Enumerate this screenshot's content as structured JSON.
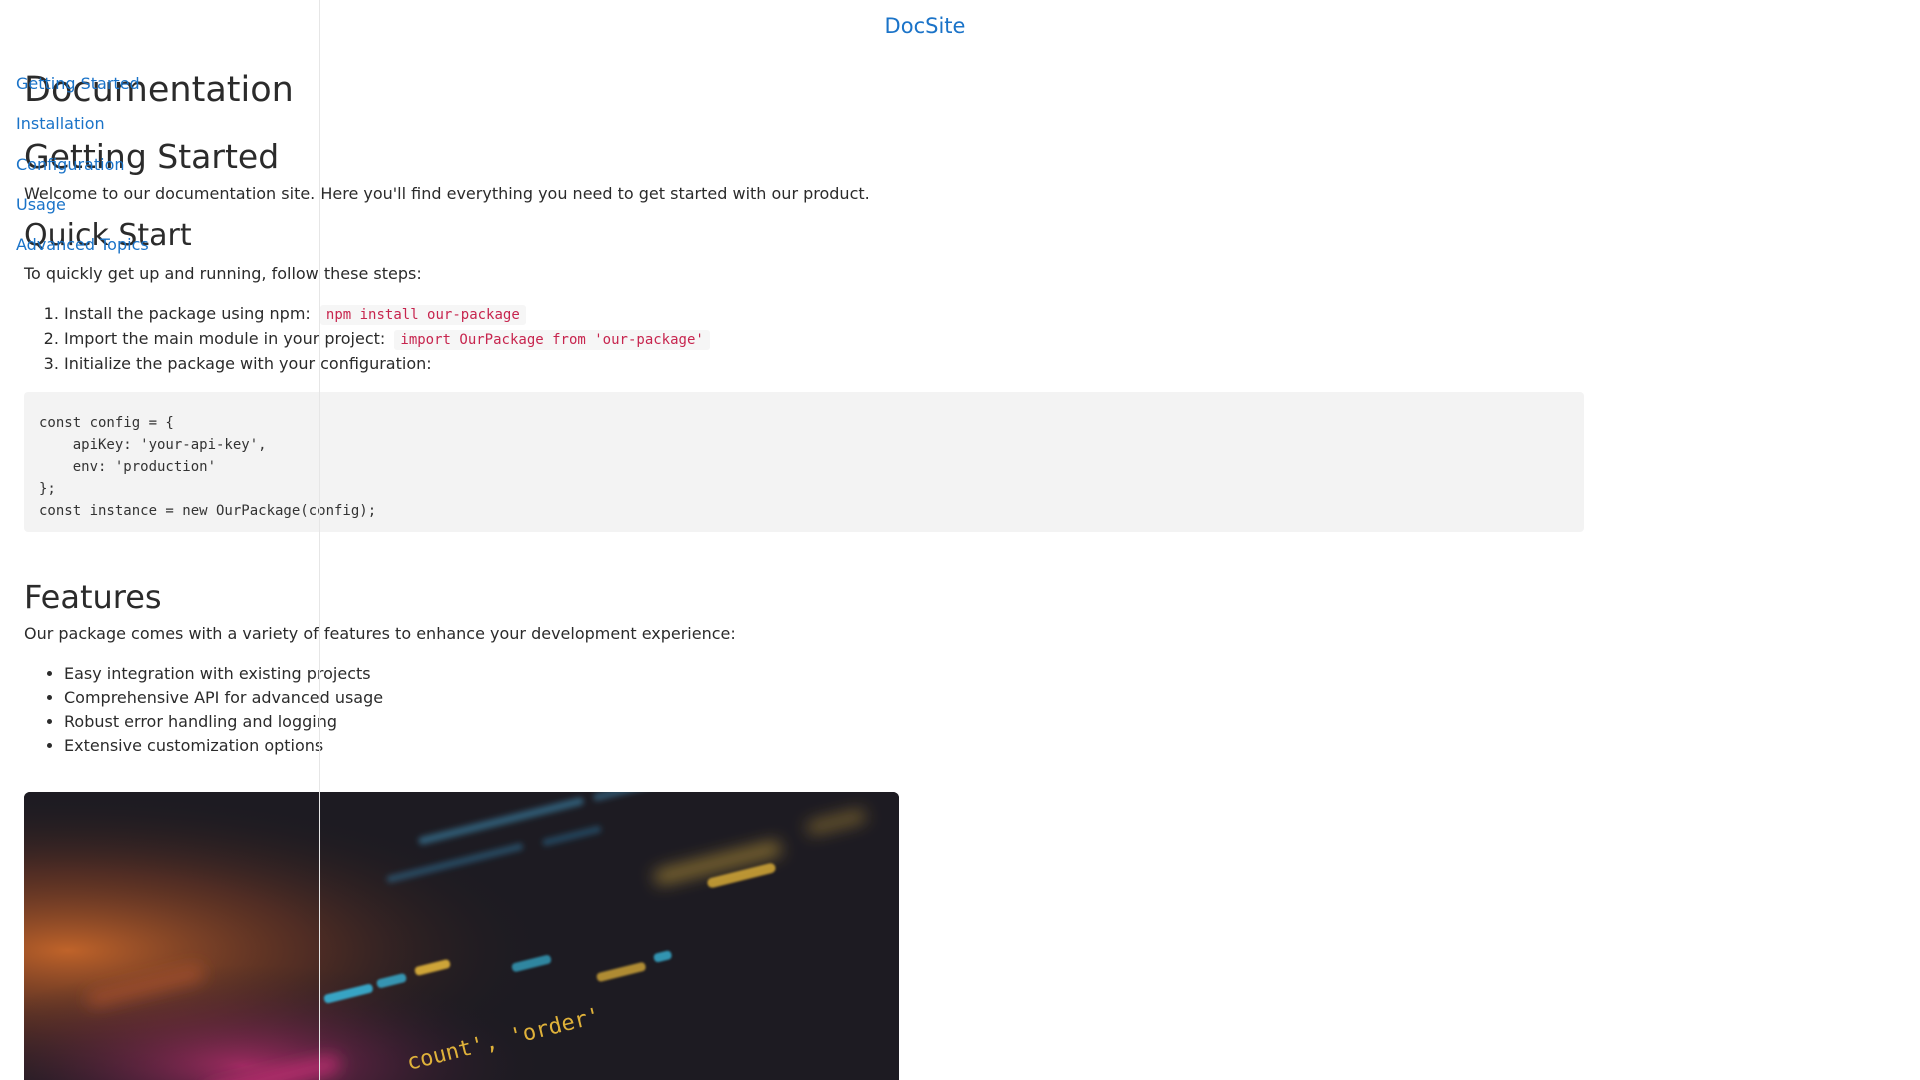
{
  "site": {
    "title": "DocSite"
  },
  "sidebar": {
    "items": [
      {
        "label": "Getting Started"
      },
      {
        "label": "Installation"
      },
      {
        "label": "Configuration"
      },
      {
        "label": "Usage"
      },
      {
        "label": "Advanced Topics"
      }
    ]
  },
  "main": {
    "page_title": "Documentation",
    "getting_started": {
      "heading": "Getting Started",
      "intro": "Welcome to our documentation site. Here you'll find everything you need to get started with our product."
    },
    "quick_start": {
      "heading": "Quick Start",
      "intro": "To quickly get up and running, follow these steps:",
      "steps": [
        {
          "text": "Install the package using npm:",
          "code": "npm install our-package"
        },
        {
          "text": "Import the main module in your project:",
          "code": "import OurPackage from 'our-package'"
        },
        {
          "text": "Initialize the package with your configuration:",
          "code": ""
        }
      ],
      "code_block": "const config = {\n    apiKey: 'your-api-key',\n    env: 'production'\n};\nconst instance = new OurPackage(config);"
    },
    "features": {
      "heading": "Features",
      "intro": "Our package comes with a variety of features to enhance your development experience:",
      "items": [
        "Easy integration with existing projects",
        "Comprehensive API for advanced usage",
        "Robust error handling and logging",
        "Extensive customization options"
      ]
    },
    "image": {
      "code_text": "count', 'order'",
      "colors": {
        "background": "#1d1b22",
        "orange": "#c8672a",
        "pink": "#d0307a",
        "cyan": "#39b3d6",
        "yellow": "#e0b23a"
      }
    }
  }
}
